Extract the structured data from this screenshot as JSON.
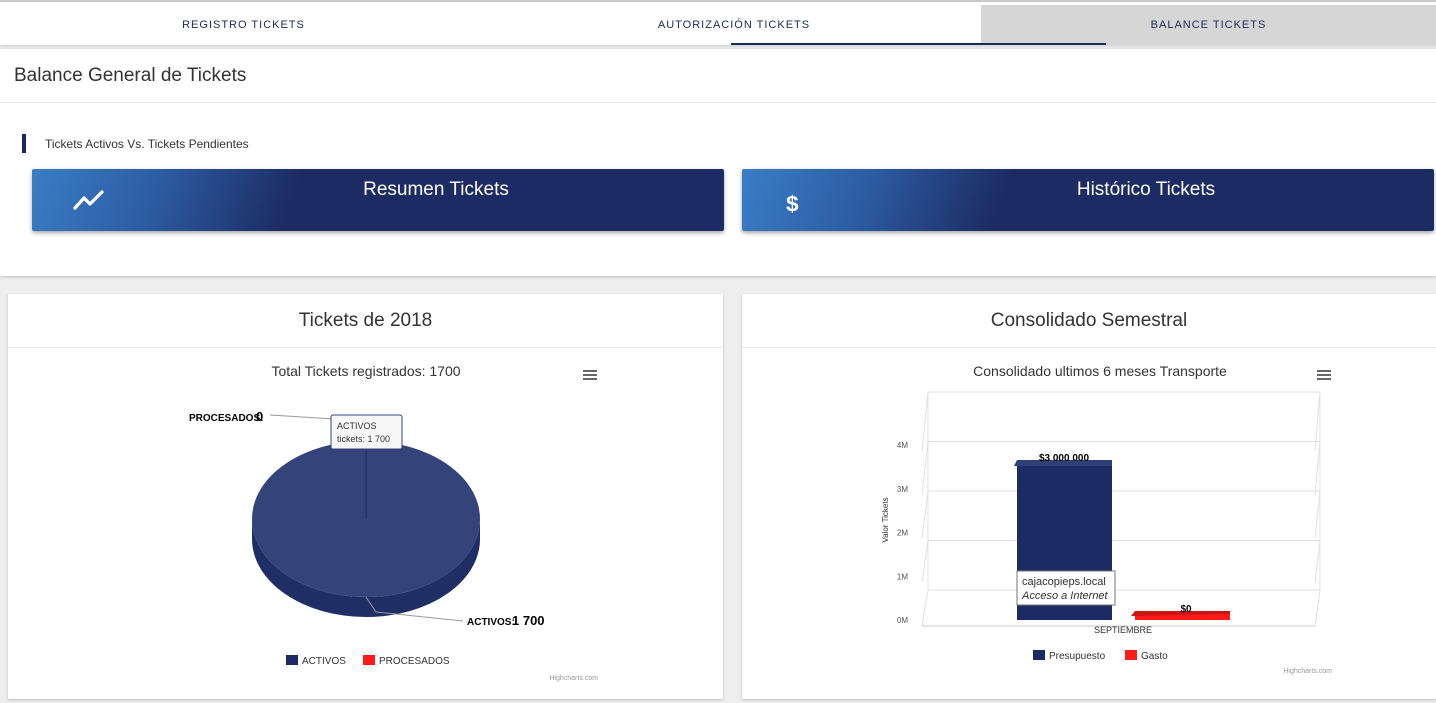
{
  "tabs": [
    {
      "label": "REGISTRO TICKETS"
    },
    {
      "label": "AUTORIZACIÓN TICKETS"
    },
    {
      "label": "BALANCE TICKETS"
    }
  ],
  "balance": {
    "title": "Balance General de Tickets",
    "subtitle": "Tickets Activos Vs. Tickets Pendientes",
    "buttons": [
      {
        "label": "Resumen Tickets",
        "icon": "trending-up-icon"
      },
      {
        "label": "Histórico Tickets",
        "icon": "dollar-icon"
      }
    ]
  },
  "panels": {
    "tickets": {
      "title": "Tickets de 2018",
      "chart_title": "Total Tickets registrados: 1700",
      "credits": "Highcharts.com",
      "tooltip": {
        "line1": "ACTIVOS",
        "line2": "tickets: 1 700"
      },
      "labels": {
        "procesados_name": "PROCESADOS:",
        "procesados_value": "0",
        "activos_name": "ACTIVOS:",
        "activos_value": "1 700"
      },
      "legend": [
        "ACTIVOS",
        "PROCESADOS"
      ]
    },
    "consolidado": {
      "title": "Consolidado Semestral",
      "chart_title": "Consolidado ultimos 6 meses Transporte",
      "ylabel": "Valor Tickets",
      "yticks": [
        "0M",
        "1M",
        "2M",
        "3M",
        "4M"
      ],
      "category": "SEPTIEMBRE",
      "bar_labels": {
        "presupuesto": "$3 000 000",
        "gasto": "$0"
      },
      "legend": [
        "Presupuesto",
        "Gasto"
      ],
      "tooltip": {
        "line1": "cajacopieps.local",
        "line2": "Acceso a Internet"
      },
      "credits": "Highcharts.com"
    }
  },
  "colors": {
    "navy": "#1c2b63",
    "pie": "#34447a",
    "pie_side": "#202e66",
    "red": "#ff1a1a"
  },
  "chart_data": [
    {
      "type": "pie",
      "title": "Total Tickets registrados: 1700",
      "categories": [
        "ACTIVOS",
        "PROCESADOS"
      ],
      "values": [
        1700,
        0
      ]
    },
    {
      "type": "bar",
      "title": "Consolidado ultimos 6 meses Transporte",
      "categories": [
        "SEPTIEMBRE"
      ],
      "series": [
        {
          "name": "Presupuesto",
          "values": [
            3000000
          ]
        },
        {
          "name": "Gasto",
          "values": [
            0
          ]
        }
      ],
      "ylabel": "Valor Tickets",
      "ylim": [
        0,
        4000000
      ],
      "grid": true,
      "legend": "bottom"
    }
  ]
}
